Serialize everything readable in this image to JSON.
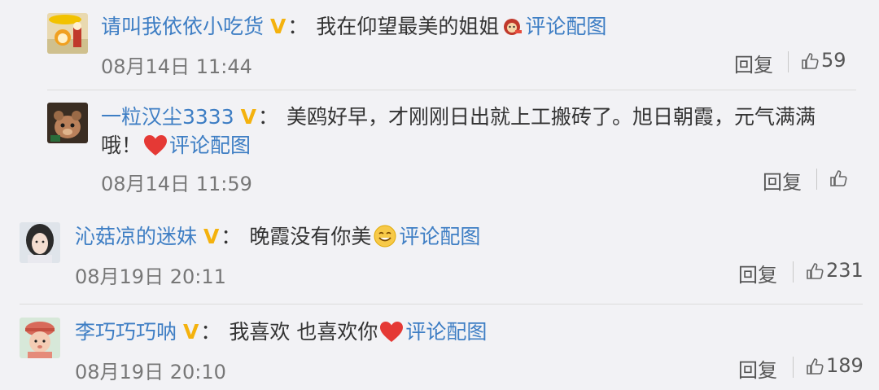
{
  "comments": [
    {
      "username": "请叫我依依小吃货",
      "text": "我在仰望最美的姐姐",
      "image_link": "评论配图",
      "time": "08月14日 11:44",
      "reply_label": "回复",
      "likes": "59"
    },
    {
      "username": "一粒汉尘3333",
      "text_line1": "美鸥好早，才刚刚日出就上工搬砖了。旭日朝霞，元气满满",
      "text_line2": "哦！",
      "image_link": "评论配图",
      "time": "08月14日 11:59",
      "reply_label": "回复",
      "likes": ""
    },
    {
      "username": "沁菇凉的迷妹",
      "text": "晚霞没有你美",
      "image_link": "评论配图",
      "time": "08月19日 20:11",
      "reply_label": "回复",
      "likes": "231"
    },
    {
      "username": "李巧巧巧呐",
      "text": "我喜欢 也喜欢你",
      "image_link": "评论配图",
      "time": "08月19日 20:10",
      "reply_label": "回复",
      "likes": "189"
    }
  ],
  "vip_mark": "V",
  "colon": "：",
  "colors": {
    "link": "#3e7ec4",
    "vip": "#f4b20e",
    "heart": "#e53935"
  }
}
